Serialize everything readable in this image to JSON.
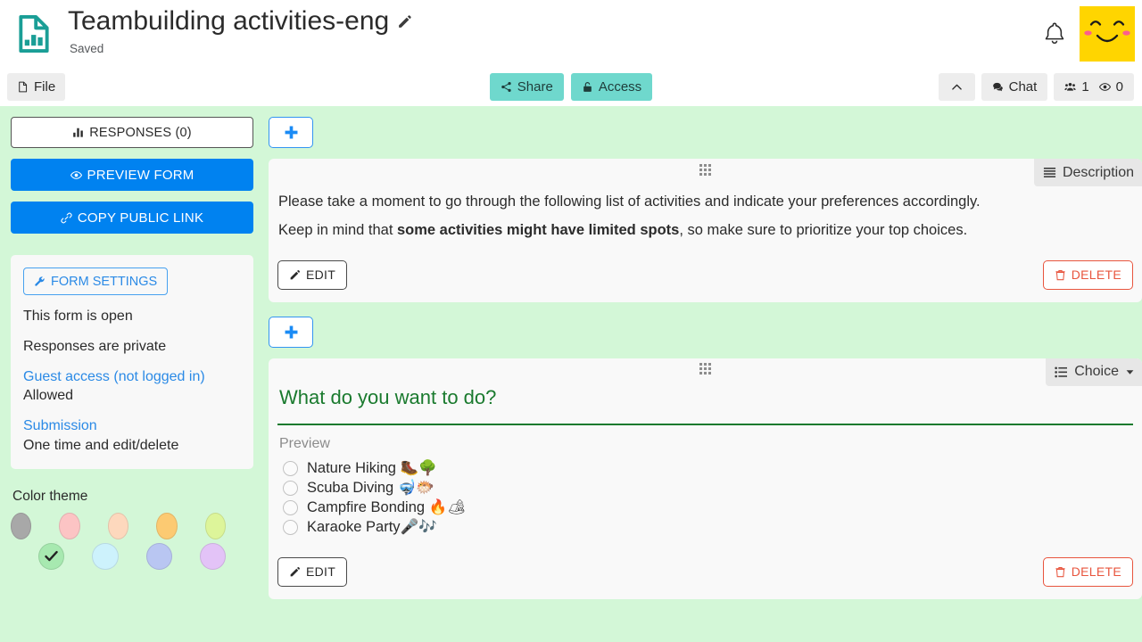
{
  "header": {
    "logo_icon": "document-chart-icon",
    "title": "Teambuilding activities-eng",
    "edit_icon": "pencil-icon",
    "status": "Saved",
    "bell_icon": "bell-icon",
    "avatar_icon": "smiley-avatar"
  },
  "toolbar": {
    "file_label": "File",
    "file_icon": "file-icon",
    "share_label": "Share",
    "share_icon": "share-icon",
    "access_label": "Access",
    "access_icon": "lock-icon",
    "collapse_icon": "chevron-up-icon",
    "chat_label": "Chat",
    "chat_icon": "chat-icon",
    "people_icon": "people-icon",
    "people_count": "1",
    "views_icon": "eye-icon",
    "views_count": "0"
  },
  "sidebar": {
    "responses_label": "RESPONSES (0)",
    "responses_icon": "bar-chart-icon",
    "preview_label": "PREVIEW FORM",
    "preview_icon": "eye-icon",
    "copy_link_label": "COPY PUBLIC LINK",
    "copy_link_icon": "link-icon",
    "settings_label": "FORM SETTINGS",
    "settings_icon": "wrench-icon",
    "status_open": "This form is open",
    "status_private": "Responses are private",
    "guest_access_link": "Guest access (not logged in)",
    "guest_access_value": "Allowed",
    "submission_link": "Submission",
    "submission_value": "One time and edit/delete",
    "theme_title": "Color theme",
    "theme_swatches": [
      {
        "name": "gray",
        "color": "#a8a8a8",
        "selected": false
      },
      {
        "name": "pink",
        "color": "#fcc4c4",
        "selected": false
      },
      {
        "name": "peach",
        "color": "#fdd8bd",
        "selected": false
      },
      {
        "name": "orange",
        "color": "#fcca72",
        "selected": false
      },
      {
        "name": "lime",
        "color": "#ddf59a",
        "selected": false
      },
      {
        "name": "green",
        "color": "#a7e9b0",
        "selected": true
      },
      {
        "name": "cyan",
        "color": "#cdf2fc",
        "selected": false
      },
      {
        "name": "blue",
        "color": "#b9c6f2",
        "selected": false
      },
      {
        "name": "purple",
        "color": "#e3c3f7",
        "selected": false
      }
    ]
  },
  "main": {
    "add_button_icon": "plus-icon",
    "grip_icon": "grip-dots-icon",
    "cards": [
      {
        "type": "description",
        "badge_label": "Description",
        "badge_icon": "lines-icon",
        "paragraph_1": "Please take a moment to go through the following list of activities and indicate your preferences accordingly.",
        "paragraph_2_pre": "Keep in mind that ",
        "paragraph_2_bold": "some activities might have limited spots",
        "paragraph_2_post": ", so make sure to prioritize your top choices.",
        "edit_label": "EDIT",
        "edit_icon": "pencil-icon",
        "delete_label": "DELETE",
        "delete_icon": "trash-icon"
      },
      {
        "type": "choice",
        "badge_label": "Choice",
        "badge_icon": "list-icon",
        "badge_caret_icon": "caret-down-icon",
        "question": "What do you want to do?",
        "preview_label": "Preview",
        "options": [
          "Nature Hiking 🥾🌳",
          "Scuba Diving 🤿🐡",
          "Campfire Bonding 🔥🏕",
          "Karaoke Party🎤🎶"
        ],
        "edit_label": "EDIT",
        "edit_icon": "pencil-icon",
        "delete_label": "DELETE",
        "delete_icon": "trash-icon"
      }
    ]
  },
  "colors": {
    "canvas_green": "#d3f7d7",
    "accent_blue": "#0082f0",
    "teal": "#6fd8cd",
    "green_heading": "#1a7a2e",
    "danger_red": "#e8553e",
    "avatar_yellow": "#ffd500"
  }
}
